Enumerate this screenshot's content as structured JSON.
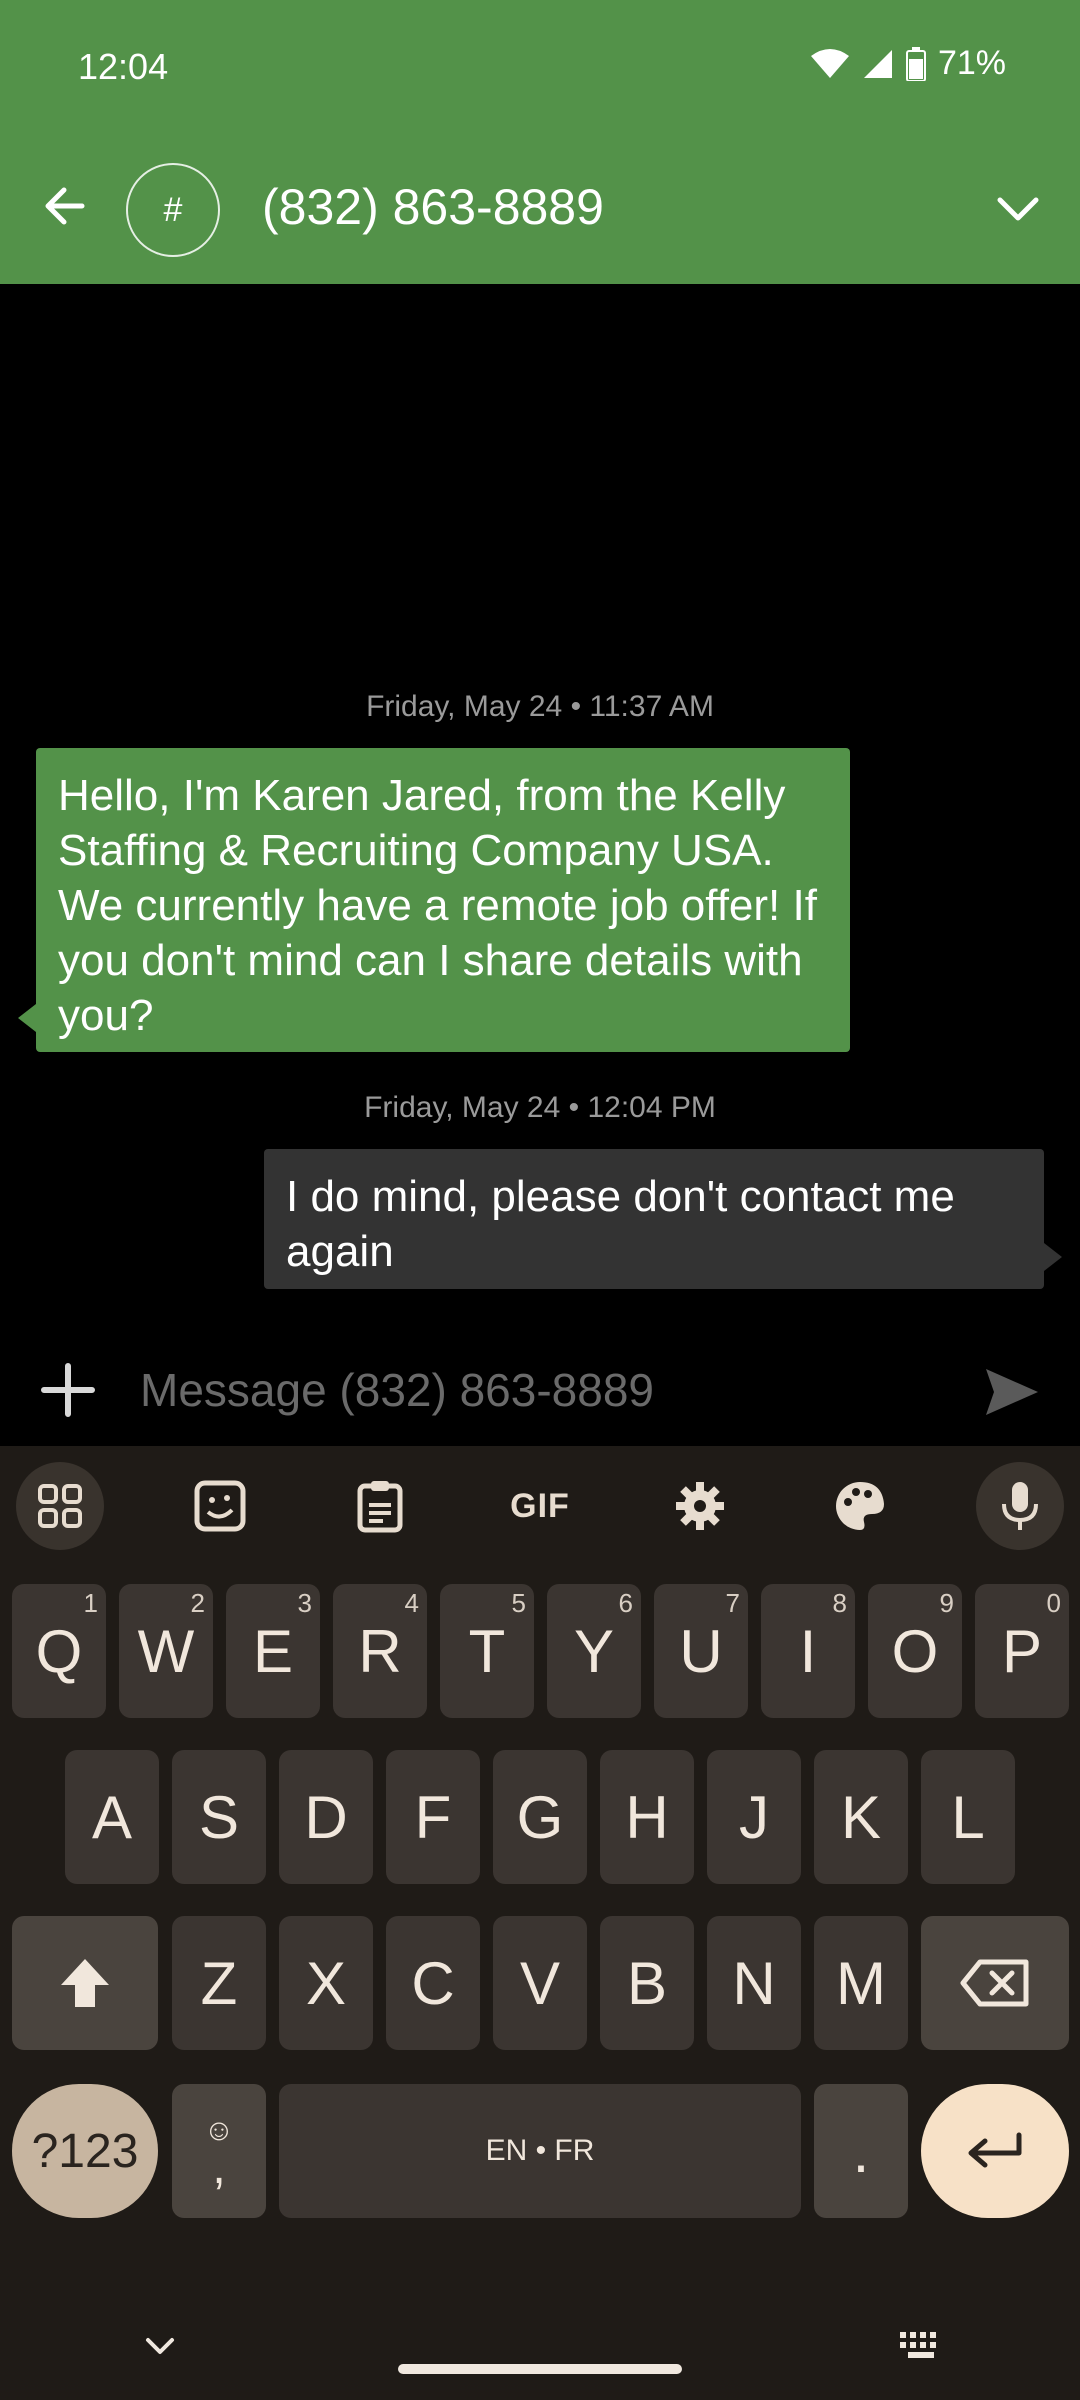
{
  "status_bar": {
    "time": "12:04",
    "battery": "71%"
  },
  "header": {
    "avatar_symbol": "#",
    "title": "(832) 863-8889"
  },
  "messages": [
    {
      "timestamp": "Friday, May 24 • 11:37 AM",
      "text": "Hello, I'm Karen Jared, from the Kelly Staffing &  Recruiting Company USA. We currently have a remote job offer! If you don't mind can I share details with you?",
      "direction": "incoming"
    },
    {
      "timestamp": "Friday, May 24 • 12:04 PM",
      "text": "I do mind, please don't contact me again",
      "direction": "outgoing"
    }
  ],
  "compose": {
    "placeholder": "Message (832) 863-8889",
    "value": ""
  },
  "keyboard": {
    "toolbar": [
      "apps-grid-icon",
      "sticker-icon",
      "clipboard-icon",
      "GIF",
      "gear-icon",
      "palette-icon",
      "mic-icon"
    ],
    "row1": [
      {
        "k": "Q",
        "h": "1"
      },
      {
        "k": "W",
        "h": "2"
      },
      {
        "k": "E",
        "h": "3"
      },
      {
        "k": "R",
        "h": "4"
      },
      {
        "k": "T",
        "h": "5"
      },
      {
        "k": "Y",
        "h": "6"
      },
      {
        "k": "U",
        "h": "7"
      },
      {
        "k": "I",
        "h": "8"
      },
      {
        "k": "O",
        "h": "9"
      },
      {
        "k": "P",
        "h": "0"
      }
    ],
    "row2": [
      "A",
      "S",
      "D",
      "F",
      "G",
      "H",
      "J",
      "K",
      "L"
    ],
    "row3": [
      "Z",
      "X",
      "C",
      "V",
      "B",
      "N",
      "M"
    ],
    "symbols_key": "?123",
    "comma_key": ",",
    "emoji_glyph": "☺",
    "space_label": "EN • FR",
    "period_key": "."
  },
  "colors": {
    "accent": "#539249",
    "keyboard_bg": "#1f1b17",
    "outgoing_bubble": "#333333"
  }
}
